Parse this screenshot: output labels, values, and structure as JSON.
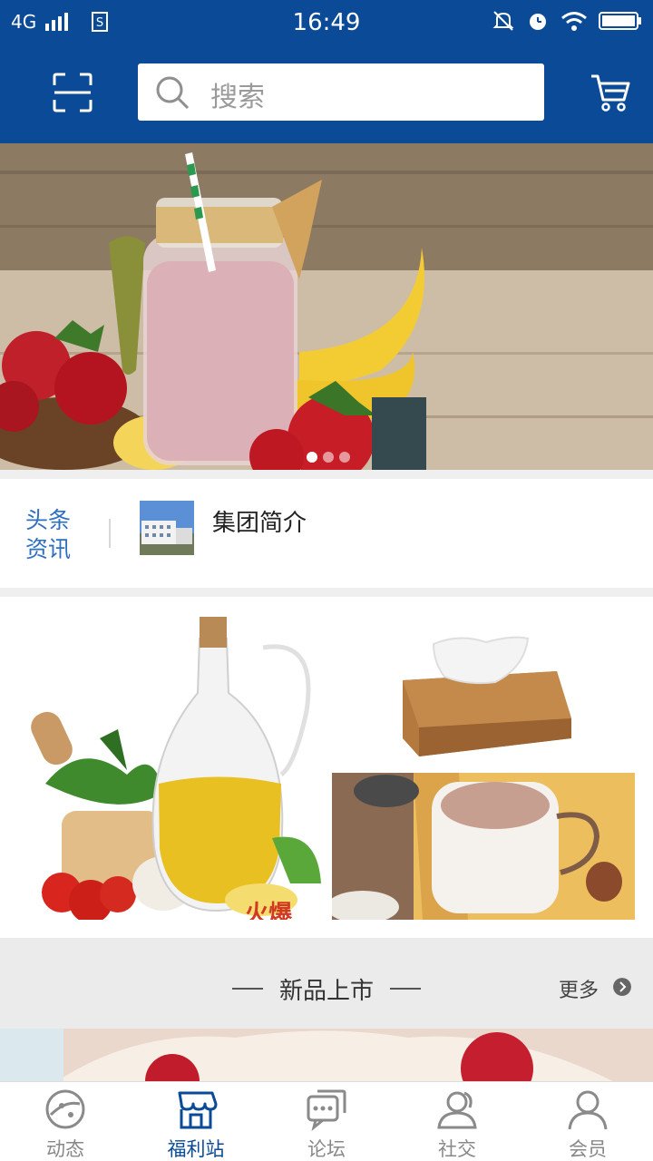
{
  "status_bar": {
    "network": "4G",
    "time": "16:49"
  },
  "header": {
    "search_placeholder": "搜索",
    "icons": [
      "scan-icon",
      "search-icon",
      "cart-icon"
    ]
  },
  "banner": {
    "slides": 3,
    "active_slide": 1
  },
  "headline": {
    "label_line1": "头条",
    "label_line2": "资讯",
    "title": "集团简介"
  },
  "new_products": {
    "title": "新品上市",
    "more": "更多"
  },
  "tabbar": {
    "items": [
      {
        "label": "动态",
        "icon": "planet-icon"
      },
      {
        "label": "福利站",
        "icon": "store-icon"
      },
      {
        "label": "论坛",
        "icon": "chat-icon"
      },
      {
        "label": "社交",
        "icon": "people-icon"
      },
      {
        "label": "会员",
        "icon": "user-icon"
      }
    ],
    "active_index": 1
  },
  "colors": {
    "brand_blue": "#0a4a96",
    "accent_blue": "#2f6fbf"
  }
}
